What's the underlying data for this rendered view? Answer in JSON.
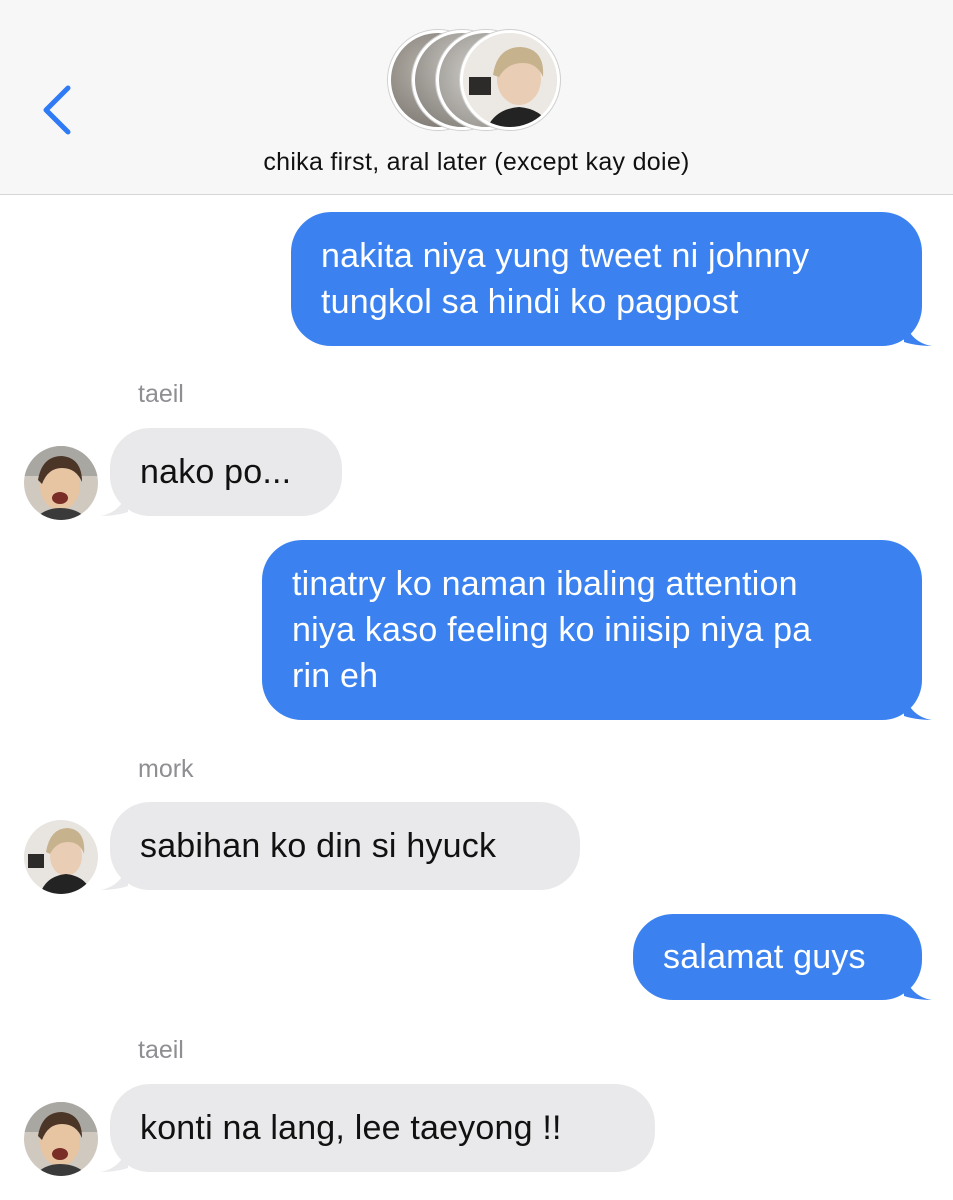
{
  "header": {
    "title": "chika first, aral later (except kay doie)"
  },
  "messages": [
    {
      "direction": "out",
      "text_lines": [
        "nakita niya yung tweet ni johnny",
        "tungkol sa hindi ko pagpost"
      ]
    },
    {
      "direction": "in",
      "sender": "taeil",
      "text": "nako po..."
    },
    {
      "direction": "out",
      "text_lines": [
        "tinatry ko naman ibaling attention",
        "niya kaso feeling ko iniisip niya pa",
        "rin eh"
      ]
    },
    {
      "direction": "in",
      "sender": "mork",
      "text": "sabihan ko din si hyuck"
    },
    {
      "direction": "out",
      "text": "salamat guys"
    },
    {
      "direction": "in",
      "sender": "taeil",
      "text": "konti na lang, lee taeyong !!"
    }
  ],
  "colors": {
    "outgoing_bubble": "#3b82f0",
    "incoming_bubble": "#e9e9eb",
    "accent": "#2f7bf5",
    "sender_label": "#8e8e93"
  },
  "icons": {
    "back": "chevron-left-icon",
    "avatars": "avatar-photo"
  }
}
